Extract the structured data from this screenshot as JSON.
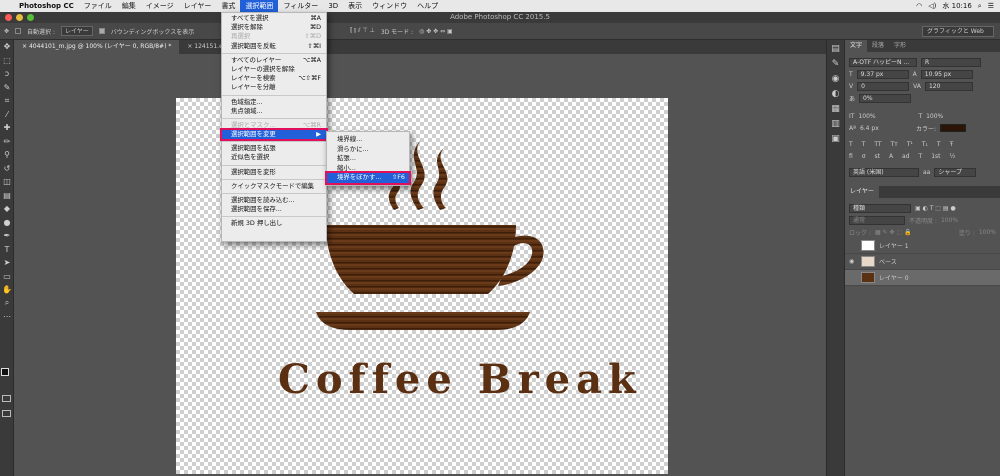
{
  "menubar": {
    "app": "Photoshop CC",
    "items": [
      "ファイル",
      "編集",
      "イメージ",
      "レイヤー",
      "書式",
      "選択範囲",
      "フィルター",
      "3D",
      "表示",
      "ウィンドウ",
      "ヘルプ"
    ],
    "active_index": 5,
    "clock": "水 10:16"
  },
  "window": {
    "title": "Adobe Photoshop CC 2015.5"
  },
  "options": {
    "auto_select": "自動選択 :",
    "layer_select": "レイヤー",
    "show_transform": "バウンディングボックスを表示",
    "mode3d": "3D モード :",
    "workspace": "グラフィックと Web"
  },
  "tabs": [
    {
      "label": "4044101_m.jpg @ 100% (レイヤー 0, RGB/8#) *"
    },
    {
      "label": "124151.eps"
    }
  ],
  "menu": {
    "items": [
      {
        "label": "すべてを選択",
        "shortcut": "⌘A"
      },
      {
        "label": "選択を解除",
        "shortcut": "⌘D"
      },
      {
        "label": "再選択",
        "shortcut": "⇧⌘D"
      },
      {
        "label": "選択範囲を反転",
        "shortcut": "⇧⌘I"
      },
      {
        "label": "すべてのレイヤー",
        "shortcut": "⌥⌘A"
      },
      {
        "label": "レイヤーの選択を解除",
        "shortcut": ""
      },
      {
        "label": "レイヤーを検索",
        "shortcut": "⌥⇧⌘F"
      },
      {
        "label": "レイヤーを分離",
        "shortcut": ""
      },
      {
        "label": "色域指定...",
        "shortcut": ""
      },
      {
        "label": "焦点領域...",
        "shortcut": ""
      },
      {
        "label": "選択とマスク...",
        "shortcut": "⌥⌘R"
      },
      {
        "label": "選択範囲を変更",
        "shortcut": "▶"
      },
      {
        "label": "選択範囲を拡張",
        "shortcut": ""
      },
      {
        "label": "近似色を選択",
        "shortcut": ""
      },
      {
        "label": "選択範囲を変形",
        "shortcut": ""
      },
      {
        "label": "クイックマスクモードで編集",
        "shortcut": ""
      },
      {
        "label": "選択範囲を読み込む...",
        "shortcut": ""
      },
      {
        "label": "選択範囲を保存...",
        "shortcut": ""
      },
      {
        "label": "新規 3D 押し出し",
        "shortcut": ""
      }
    ]
  },
  "submenu": {
    "items": [
      {
        "label": "境界線...",
        "shortcut": ""
      },
      {
        "label": "滑らかに...",
        "shortcut": ""
      },
      {
        "label": "拡張...",
        "shortcut": ""
      },
      {
        "label": "縮小...",
        "shortcut": ""
      },
      {
        "label": "境界をぼかす...",
        "shortcut": "⇧F6"
      }
    ]
  },
  "canvas": {
    "text": "Coffee Break"
  },
  "charpanel": {
    "tabs": [
      "文字",
      "段落",
      "字形"
    ],
    "font": "A-OTF ハッピーN ...",
    "style": "R",
    "size": "9.37 px",
    "leading": "10.95 px",
    "kerning": "0",
    "tracking": "120",
    "tsume": "0%",
    "vscale": "100%",
    "hscale": "100%",
    "baseline": "6.4 px",
    "color_label": "カラー:",
    "lang": "英語 (米国)",
    "aa": "シャープ"
  },
  "layers": {
    "tab": "レイヤー",
    "filter": "種類",
    "blend": "通常",
    "opacity_label": "不透明度 :",
    "opacity": "100%",
    "lock_label": "ロック :",
    "fill_label": "塗り :",
    "fill": "100%",
    "items": [
      {
        "name": "レイヤー 1"
      },
      {
        "name": "ベース"
      },
      {
        "name": "レイヤー 0"
      }
    ]
  }
}
